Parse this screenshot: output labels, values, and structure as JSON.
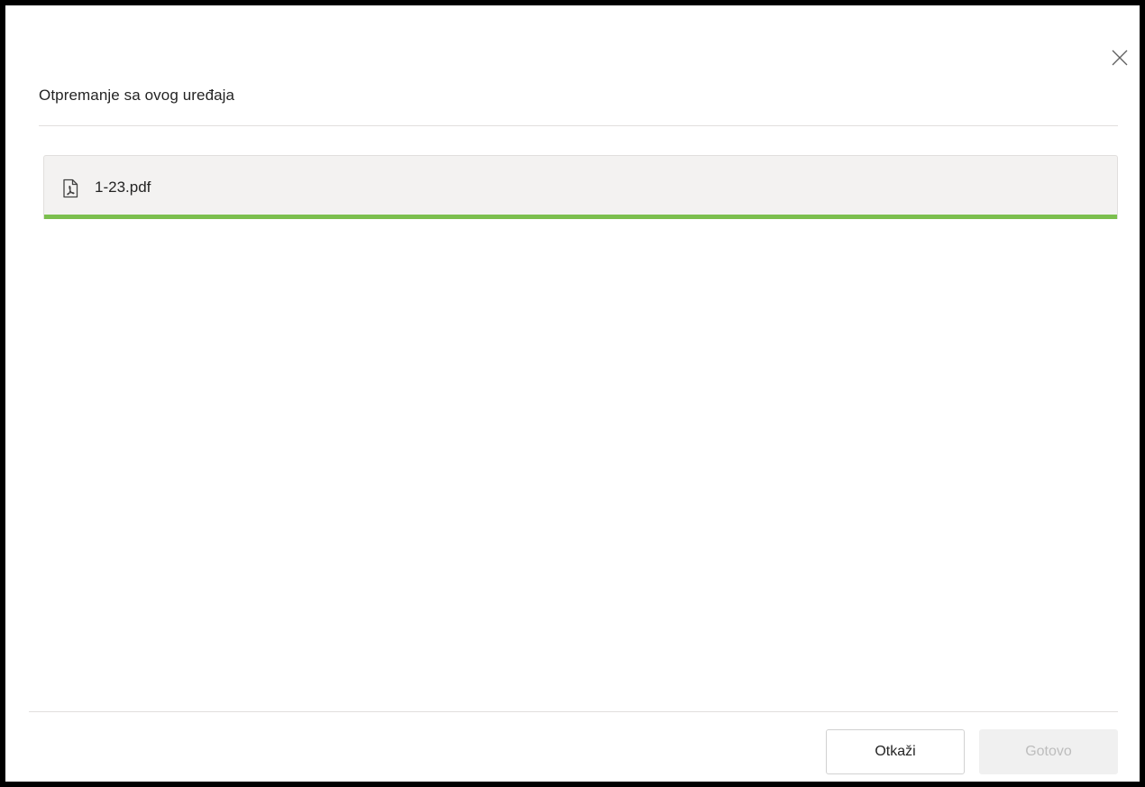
{
  "dialog": {
    "title": "Otpremanje sa ovog uređaja",
    "close_icon": "close-icon"
  },
  "files": [
    {
      "name": "1-23.pdf",
      "icon": "pdf-file-icon",
      "progress_percent": 100,
      "progress_color": "#7bbf4e"
    }
  ],
  "footer": {
    "cancel_label": "Otkaži",
    "done_label": "Gotovo",
    "done_enabled": false
  }
}
